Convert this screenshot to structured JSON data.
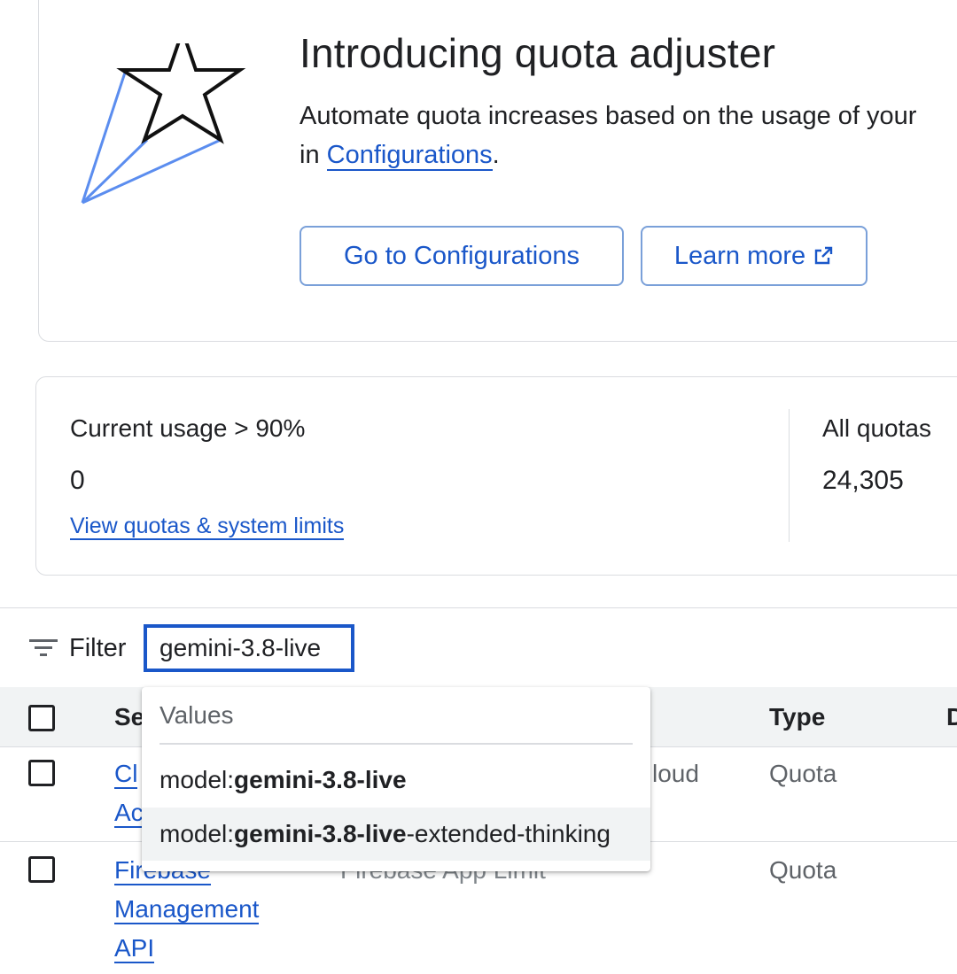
{
  "promo": {
    "title": "Introducing quota adjuster",
    "desc_line1": "Automate quota increases based on the usage of your",
    "desc_line2_prefix": "in ",
    "desc_link": "Configurations",
    "desc_line2_suffix": ".",
    "btn_configurations": "Go to Configurations",
    "btn_learn_more": "Learn more",
    "illustration_icon": "shooting-star-icon",
    "external_icon": "open-in-new-icon"
  },
  "stats": {
    "usage_label": "Current usage > 90%",
    "usage_value": "0",
    "usage_link": "View quotas & system limits",
    "all_label": "All quotas",
    "all_value": "24,305"
  },
  "filter": {
    "label": "Filter",
    "icon": "filter-list-icon",
    "chip_value": "gemini-3.8-live"
  },
  "table": {
    "col_service_partial": "Se",
    "col_type": "Type",
    "col_next_partial": "D",
    "rows": [
      {
        "service_line1_partial": "Cl",
        "service_line2_partial": "Ac",
        "name_partial": "loud",
        "type": "Quota"
      },
      {
        "service_line1": "Firebase",
        "service_line2": "Management",
        "service_line3": "API",
        "name_partial": "Firebase App Limit",
        "type": "Quota"
      }
    ]
  },
  "dropdown": {
    "header": "Values",
    "items": [
      {
        "prefix": "model:",
        "bold": "gemini-3.8-live",
        "suffix": ""
      },
      {
        "prefix": "model:",
        "bold": "gemini-3.8-live",
        "suffix": "-extended-thinking"
      }
    ]
  },
  "colors": {
    "accent": "#1a57c9",
    "illustration_blue": "#5b8def",
    "border": "#dadce0"
  }
}
